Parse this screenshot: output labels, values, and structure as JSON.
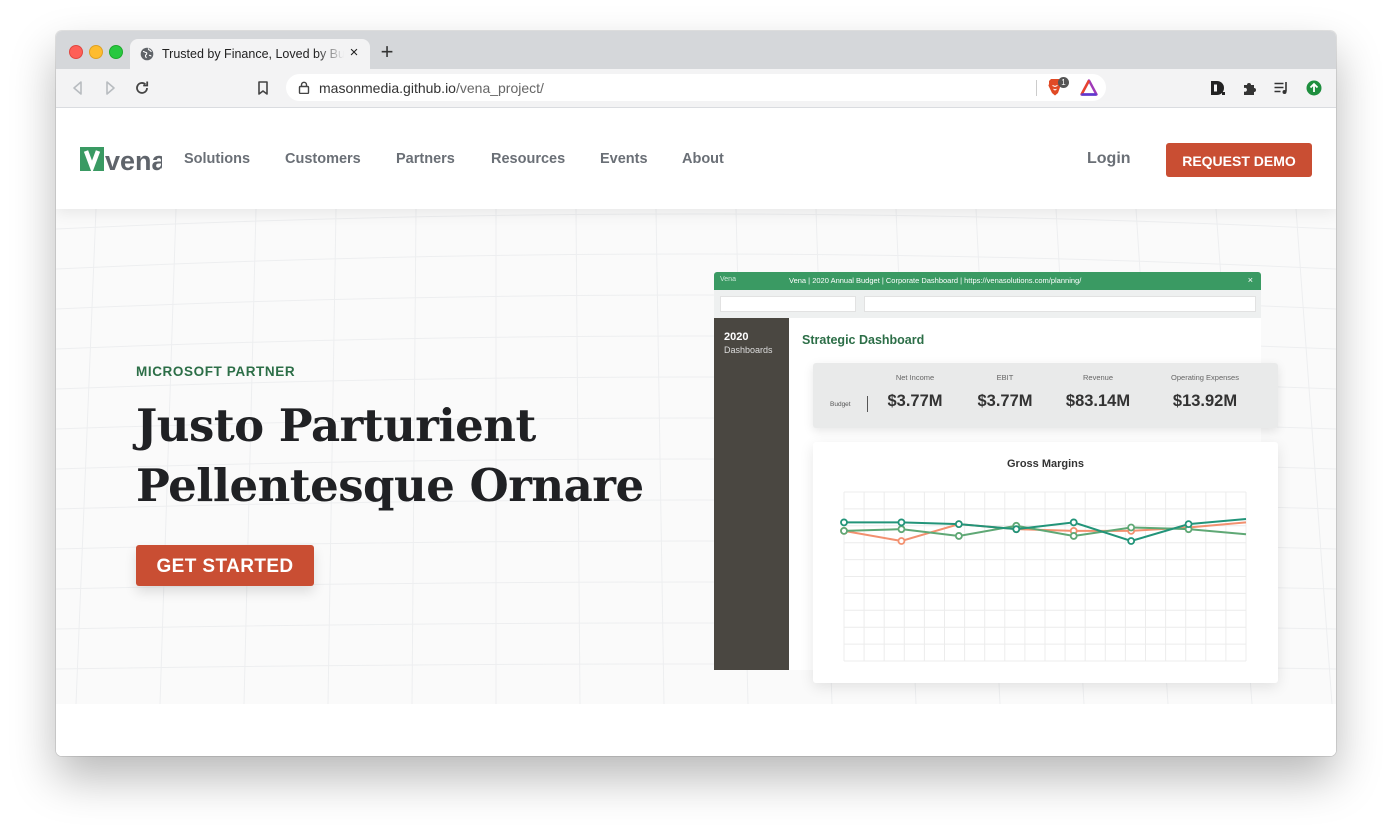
{
  "browser": {
    "tab_title": "Trusted by Finance, Loved by Business",
    "tab_close": "×",
    "new_tab": "+",
    "url_host": "masonmedia.github.io",
    "url_path": "/vena_project/",
    "shields_badge": "1"
  },
  "header": {
    "logo_text": "vena",
    "nav": [
      "Solutions",
      "Customers",
      "Partners",
      "Resources",
      "Events",
      "About"
    ],
    "login_label": "Login",
    "demo_label": "REQUEST DEMO"
  },
  "hero": {
    "eyebrow": "MICROSOFT PARTNER",
    "headline_line1": "Justo Parturient",
    "headline_line2": "Pellentesque Ornare",
    "cta_label": "GET STARTED"
  },
  "dashboard": {
    "brand": "Vena",
    "window_title": "Vena | 2020 Annual Budget | Corporate Dashboard | https://venasolutions.com/planning/",
    "close": "×",
    "sidebar_year": "2020",
    "sidebar_label": "Dashboards",
    "heading": "Strategic Dashboard",
    "budget_label": "Budget",
    "kpis": [
      {
        "label": "Net Income",
        "value": "$3.77M"
      },
      {
        "label": "EBIT",
        "value": "$3.77M"
      },
      {
        "label": "Revenue",
        "value": "$83.14M"
      },
      {
        "label": "Operating Expenses",
        "value": "$13.92M"
      }
    ]
  },
  "chart_data": {
    "type": "line",
    "title": "Gross Margins",
    "x": [
      1,
      2,
      3,
      4,
      5,
      6,
      7,
      8
    ],
    "ylim": [
      0,
      100
    ],
    "grid": true,
    "series": [
      {
        "color": "#f2906f",
        "values": [
          77,
          71,
          81,
          78,
          77,
          77,
          79,
          82
        ],
        "markers": [
          1,
          1,
          1,
          1,
          1,
          1,
          1,
          0
        ]
      },
      {
        "color": "#5fa875",
        "values": [
          77,
          78,
          74,
          80,
          74,
          79,
          78,
          75
        ],
        "markers": [
          1,
          1,
          1,
          1,
          1,
          1,
          1,
          0
        ]
      },
      {
        "color": "#229479",
        "values": [
          82,
          82,
          81,
          78,
          82,
          71,
          81,
          84
        ],
        "markers": [
          1,
          1,
          1,
          1,
          1,
          1,
          1,
          0
        ]
      }
    ]
  },
  "colors": {
    "brand_green": "#3a9a63",
    "accent_orange": "#c94e33",
    "eyebrow_green": "#2c6e47"
  }
}
